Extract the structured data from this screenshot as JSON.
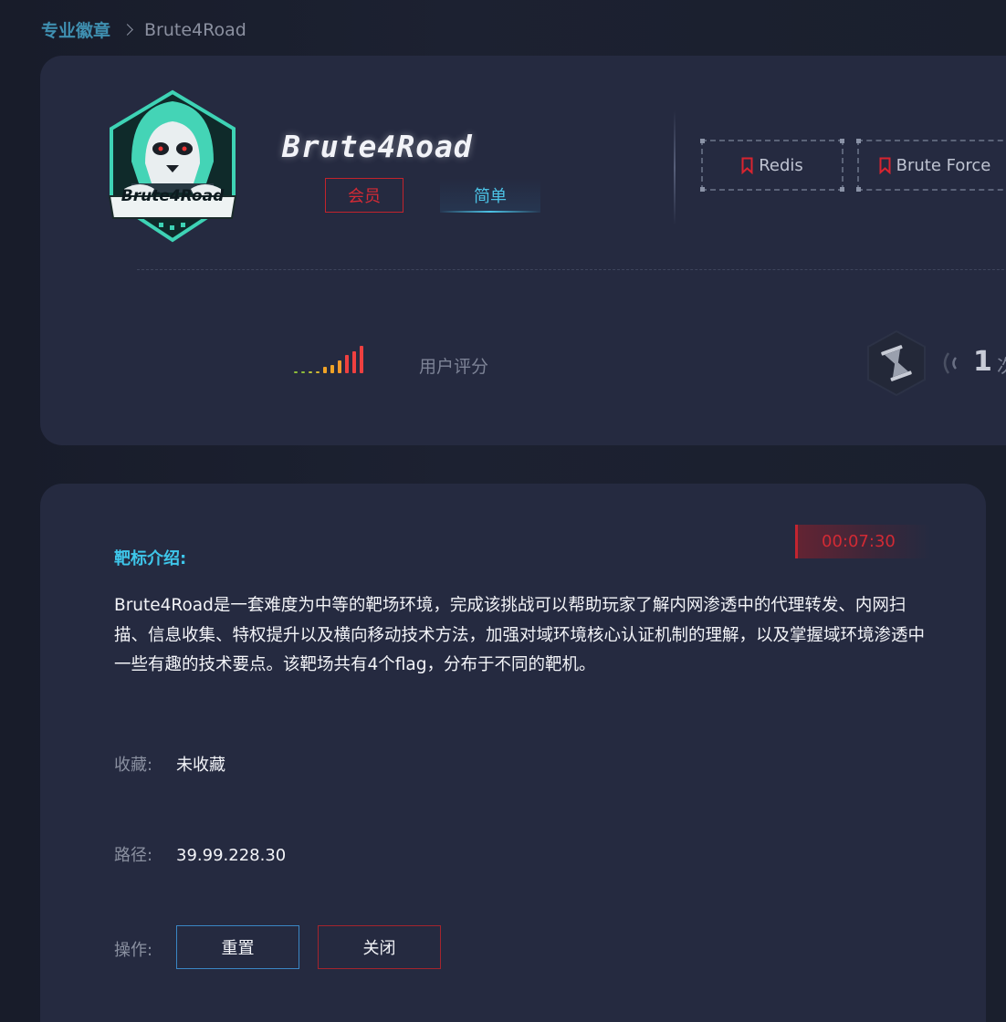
{
  "breadcrumb": {
    "parent": "专业徽章",
    "current": "Brute4Road"
  },
  "header": {
    "logo_text": "Brute4Road",
    "title": "Brute4Road",
    "badge_member": "会员",
    "badge_difficulty": "简单",
    "tags": [
      "Redis",
      "Brute Force"
    ],
    "rating_label": "用户评分",
    "rating_bars": [
      {
        "h": 2,
        "color": "#8fbf3a"
      },
      {
        "h": 2,
        "color": "#8fbf3a"
      },
      {
        "h": 2,
        "color": "#b9c23a"
      },
      {
        "h": 2,
        "color": "#d9b830"
      },
      {
        "h": 7,
        "color": "#f0a326"
      },
      {
        "h": 9,
        "color": "#f0a326"
      },
      {
        "h": 14,
        "color": "#f29a2a"
      },
      {
        "h": 20,
        "color": "#ef4040"
      },
      {
        "h": 24,
        "color": "#ef4040"
      },
      {
        "h": 30,
        "color": "#ef4040"
      }
    ],
    "count": "1",
    "count_unit": "次"
  },
  "detail": {
    "timer": "00:07:30",
    "intro_label": "靶标介绍:",
    "intro_text": "Brute4Road是一套难度为中等的靶场环境，完成该挑战可以帮助玩家了解内网渗透中的代理转发、内网扫描、信息收集、特权提升以及横向移动技术方法，加强对域环境核心认证机制的理解，以及掌握域环境渗透中一些有趣的技术要点。该靶场共有4个flag，分布于不同的靶机。",
    "favorite_label": "收藏:",
    "favorite_value": "未收藏",
    "path_label": "路径:",
    "path_value": "39.99.228.30",
    "action_label": "操作:",
    "reset_button": "重置",
    "close_button": "关闭"
  },
  "colors": {
    "accent": "#3ec6ea",
    "danger": "#d22a34",
    "card": "#252a40"
  }
}
